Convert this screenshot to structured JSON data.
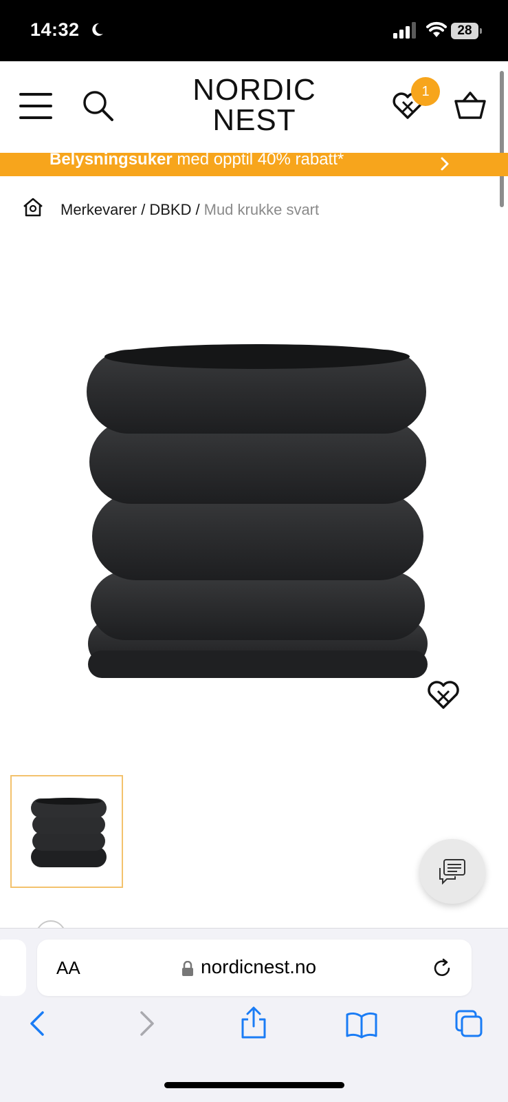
{
  "status_bar": {
    "time": "14:32",
    "battery": "28",
    "icons": [
      "moon-icon",
      "signal-icon",
      "wifi-icon",
      "battery-icon"
    ]
  },
  "header": {
    "logo_line1": "NORDIC",
    "logo_line2": "NEST",
    "wishlist_count": "1",
    "icons": [
      "menu-icon",
      "search-icon",
      "wishlist-heart-icon",
      "basket-icon"
    ],
    "accent_color": "#f7a51c"
  },
  "promo": {
    "bold_text": "Belysningsuker",
    "text": " med opptil 40% rabatt*"
  },
  "breadcrumb": {
    "items": [
      "Merkevarer",
      "DBKD"
    ],
    "current": "Mud krukke svart",
    "separator": "/"
  },
  "product": {
    "image_alt": "Mud krukke svart",
    "color": "#2b2c2e"
  },
  "browser": {
    "aa_label": "AA",
    "host": "nordicnest.no",
    "icons": [
      "lock-icon",
      "reload-icon",
      "back-icon",
      "forward-icon",
      "share-icon",
      "bookmarks-icon",
      "tabs-icon"
    ],
    "tint": "#1a7cf5"
  }
}
